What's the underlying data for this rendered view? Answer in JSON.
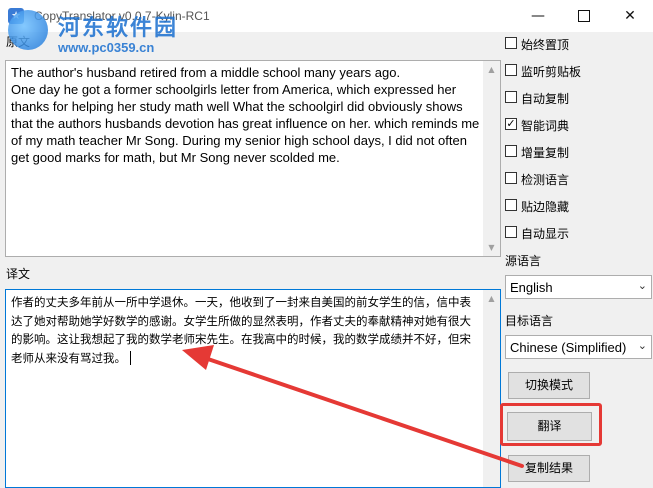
{
  "window": {
    "title": "CopyTranslator v0.0.7-Kylin-RC1",
    "minimize_glyph": "—",
    "close_glyph": "✕"
  },
  "watermark": {
    "line1": "河东软件园",
    "line2": "www.pc0359.cn"
  },
  "source": {
    "label": "原文",
    "text": "The author's husband retired from a middle school many years ago.\nOne day he got a former schoolgirls letter from America, which expressed her thanks for helping her study math well What the schoolgirl did obviously shows that the authors husbands devotion has great influence on her. which reminds me of my math teacher Mr Song. During my senior high school days, I did not often get good marks for math, but Mr Song never scolded me."
  },
  "dest": {
    "label": "译文",
    "text": "作者的丈夫多年前从一所中学退休。一天，他收到了一封来自美国的前女学生的信，信中表达了她对帮助她学好数学的感谢。女学生所做的显然表明，作者丈夫的奉献精神对她有很大的影响。这让我想起了我的数学老师宋先生。在我高中的时候，我的数学成绩并不好，但宋老师从来没有骂过我。"
  },
  "options": [
    {
      "label": "始终置顶",
      "checked": false
    },
    {
      "label": "监听剪贴板",
      "checked": false
    },
    {
      "label": "自动复制",
      "checked": false
    },
    {
      "label": "智能词典",
      "checked": true
    },
    {
      "label": "增量复制",
      "checked": false
    },
    {
      "label": "检测语言",
      "checked": false
    },
    {
      "label": "贴边隐藏",
      "checked": false
    },
    {
      "label": "自动显示",
      "checked": false
    }
  ],
  "checkmark": "✓",
  "source_lang": {
    "label": "源语言",
    "value": "English"
  },
  "target_lang": {
    "label": "目标语言",
    "value": "Chinese (Simplified)"
  },
  "buttons": {
    "switch_mode": "切换模式",
    "translate": "翻译",
    "copy_result": "复制结果"
  },
  "colors": {
    "annotation": "#e53935",
    "focus_border": "#0078d7"
  }
}
